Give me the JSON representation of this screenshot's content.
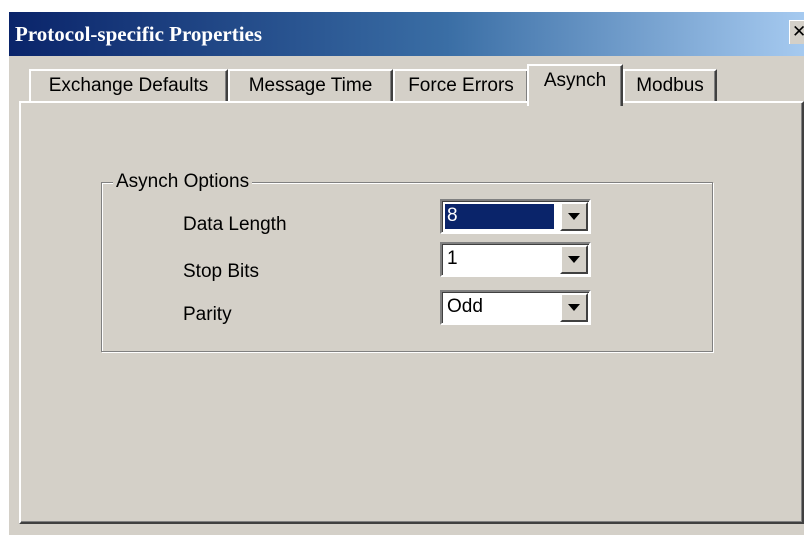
{
  "window": {
    "title": "Protocol-specific Properties",
    "close_glyph": "✕"
  },
  "tabs": [
    {
      "label": "Exchange Defaults",
      "active": false
    },
    {
      "label": "Message Time",
      "active": false
    },
    {
      "label": "Force Errors",
      "active": false
    },
    {
      "label": "Asynch",
      "active": true
    },
    {
      "label": "Modbus",
      "active": false
    }
  ],
  "group": {
    "title": "Asynch Options",
    "fields": [
      {
        "label": "Data Length",
        "value": "8",
        "selected": true
      },
      {
        "label": "Stop Bits",
        "value": "1",
        "selected": false
      },
      {
        "label": "Parity",
        "value": "Odd",
        "selected": false
      }
    ]
  },
  "icons": {
    "close": "close-icon",
    "dropdown": "chevron-down-icon"
  },
  "colors": {
    "title_gradient_start": "#0a246a",
    "title_gradient_end": "#a6caf0",
    "dialog_face": "#d4d0c8",
    "selection": "#0a246a"
  }
}
